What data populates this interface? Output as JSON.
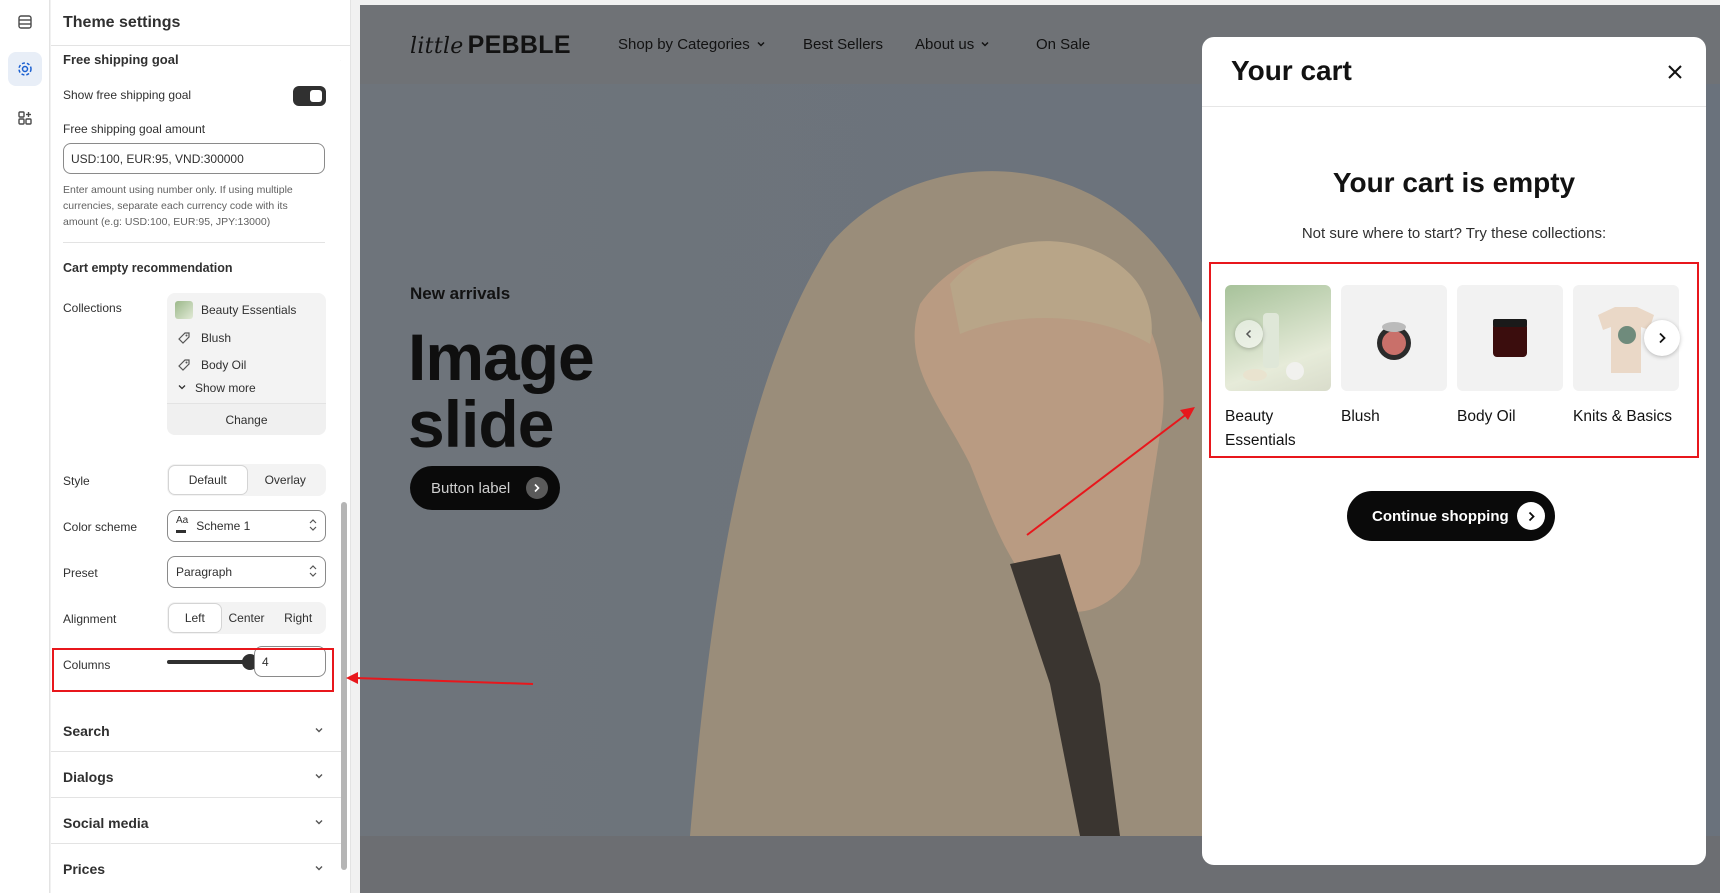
{
  "panel": {
    "title": "Theme settings",
    "free_shipping": {
      "heading": "Free shipping goal",
      "show_label": "Show free shipping goal",
      "show_enabled": true,
      "amount_label": "Free shipping goal amount",
      "amount_value": "USD:100, EUR:95, VND:300000",
      "help_line1": "Enter amount using number only. If using multiple",
      "help_line2": "currencies, separate each currency code with its",
      "help_line3": "amount (e.g: USD:100, EUR:95, JPY:13000)"
    },
    "cart_empty": {
      "heading": "Cart empty recommendation",
      "collections_label": "Collections",
      "collections": [
        "Beauty Essentials",
        "Blush",
        "Body Oil"
      ],
      "show_more": "Show more",
      "change": "Change",
      "style_label": "Style",
      "style_options": [
        "Default",
        "Overlay"
      ],
      "style_selected": "Default",
      "color_scheme_label": "Color scheme",
      "color_scheme_value": "Scheme 1",
      "preset_label": "Preset",
      "preset_value": "Paragraph",
      "alignment_label": "Alignment",
      "alignment_options": [
        "Left",
        "Center",
        "Right"
      ],
      "alignment_selected": "Left",
      "columns_label": "Columns",
      "columns_value": "4"
    },
    "accordions": [
      "Search",
      "Dialogs",
      "Social media",
      "Prices"
    ]
  },
  "store": {
    "logo_script": "little",
    "logo_word": "PEBBLE",
    "nav": [
      "Shop by Categories",
      "Best Sellers",
      "About us",
      "On Sale"
    ],
    "hero": {
      "eyebrow": "New arrivals",
      "title_line1": "Image",
      "title_line2": "slide",
      "button": "Button label"
    }
  },
  "cart": {
    "title": "Your cart",
    "empty_title": "Your cart is empty",
    "empty_sub": "Not sure where to start? Try these collections:",
    "collections": [
      "Beauty Essentials",
      "Blush",
      "Body Oil",
      "Knits & Basics"
    ],
    "continue": "Continue shopping"
  },
  "colors": {
    "annotation": "#e8171c",
    "accent": "#303030"
  }
}
